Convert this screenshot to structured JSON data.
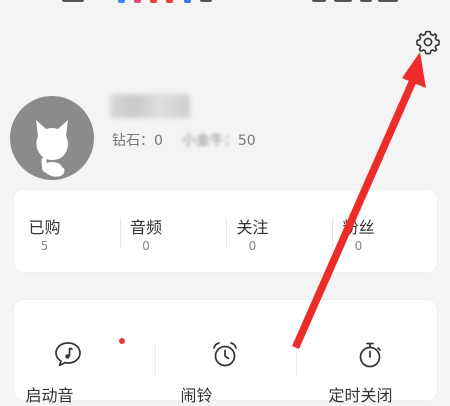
{
  "colors": {
    "background": "#f4f4f5",
    "card": "#ffffff",
    "avatar": "#8b8b8b",
    "annotation_arrow": "#ee2b2b",
    "notification_dot": "#e53935"
  },
  "header": {
    "settings_icon": "gear-icon"
  },
  "profile": {
    "avatar_icon": "cat-avatar-icon",
    "diamond_label": "钻石：0",
    "small_label": "小金牛：",
    "small_value": "50"
  },
  "stats": [
    {
      "label": "已购",
      "value": "5"
    },
    {
      "label": "音频",
      "value": "0"
    },
    {
      "label": "关注",
      "value": "0"
    },
    {
      "label": "粉丝",
      "value": "0"
    }
  ],
  "tools": [
    {
      "label": "启动音",
      "icon": "music-bubble-icon",
      "has_dot": true
    },
    {
      "label": "闹铃",
      "icon": "alarm-clock-icon",
      "has_dot": false
    },
    {
      "label": "定时关闭",
      "icon": "stopwatch-icon",
      "has_dot": false
    }
  ]
}
